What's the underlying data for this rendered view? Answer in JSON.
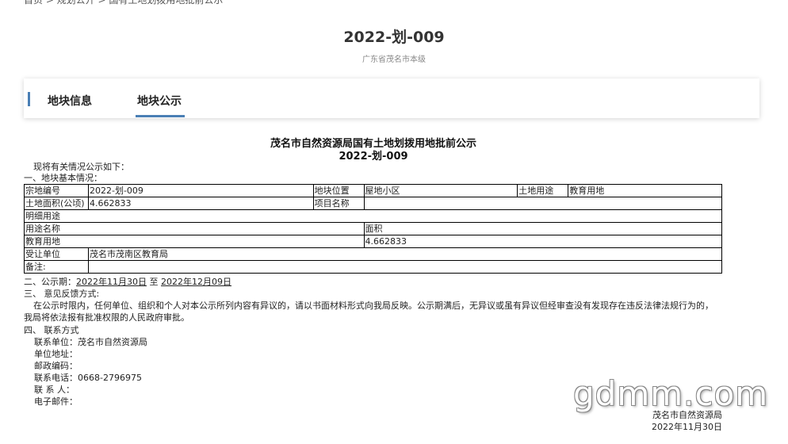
{
  "breadcrumb": "首页 > 规划公开 > 国有土地划拨用地批前公示",
  "page": {
    "title": "2022-划-009",
    "subtitle": "广东省茂名市本级"
  },
  "tabs": [
    {
      "label": "地块信息",
      "active": false
    },
    {
      "label": "地块公示",
      "active": true
    }
  ],
  "notice": {
    "title": "茂名市自然资源局国有土地划拨用地批前公示",
    "number": "2022-划-009",
    "intro": "现将有关情况公示如下：",
    "section1": "一、地块基本情况：",
    "table": {
      "r1": [
        "宗地编号",
        "2022-划-009",
        "地块位置",
        "屋地小区",
        "土地用途",
        "教育用地"
      ],
      "r2": [
        "土地面积(公顷)",
        "4.662833",
        "项目名称",
        ""
      ],
      "r3": "明细用途",
      "r4": [
        "用途名称",
        "面积"
      ],
      "r5": [
        "教育用地",
        "4.662833"
      ],
      "r6": [
        "受让单位",
        "茂名市茂南区教育局"
      ],
      "r7": [
        "备注:",
        ""
      ]
    },
    "section2_prefix": "二、公示期：",
    "period_start": "2022年11月30日",
    "period_mid": " 至 ",
    "period_end": "2022年12月09日",
    "section3": "三、 意见反馈方式:",
    "feedback": "在公示时限内，任何单位、组织和个人对本公示所列内容有异议的，请以书面材料形式向我局反映。公示期满后，无异议或虽有异议但经审查没有发现存在违反法律法规行为的，我局将依法报有批准权限的人民政府审批。",
    "section4": "四、 联系方式",
    "contacts": [
      "联系单位：茂名市自然资源局",
      "单位地址：",
      "邮政编码：",
      "联系电话：0668-2796975",
      "联 系 人：",
      "电子邮件："
    ],
    "signature_org": "茂名市自然资源局",
    "signature_date": "2022年11月30日"
  },
  "watermark": "gdmm.com"
}
